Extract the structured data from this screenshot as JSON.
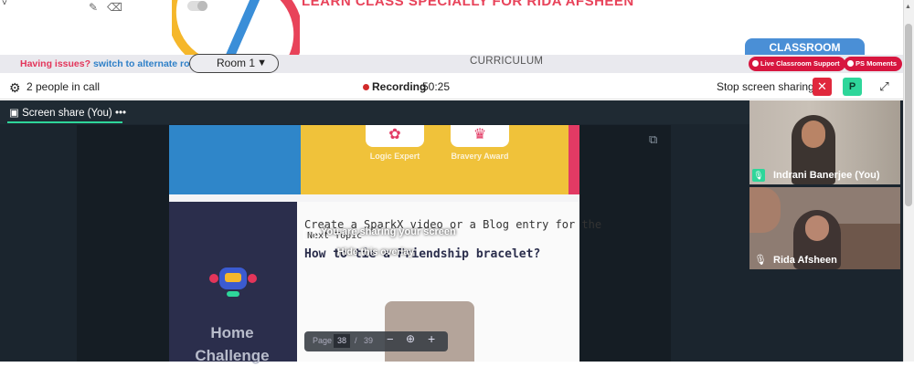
{
  "banner": {
    "title": "LEARN CLASS SPECIALLY FOR RIDA AFSHEEN"
  },
  "classroom_tab": "CLASSROOM",
  "room_bar": {
    "issues_text": "Having issues?",
    "switch_text": "switch to alternate room",
    "room_selected": "Room 1",
    "curriculum": "CURRICULUM",
    "support_pill": "Live Classroom Support",
    "moments_pill": "PS Moments"
  },
  "meeting": {
    "people": "2 people in call",
    "recording_label": "Recording",
    "recording_time": "50:25",
    "stop_sharing": "Stop screen sharing",
    "avatar_initial": "P"
  },
  "screen_share": {
    "tab_label": "Screen share (You)",
    "tab_menu": "•••",
    "overlay_title": "You are sharing your screen",
    "overlay_hide": "Hide this overlay"
  },
  "document": {
    "badge1": "Logic Expert",
    "badge2": "Bravery Award",
    "line1": "Create a SparkX video or a Blog entry for the",
    "line2": "Next Topic",
    "heading": "How to tie a Friendship bracelet?",
    "home_challenge": "Home Challenge"
  },
  "pager": {
    "label": "Page",
    "current": "38",
    "separator": "/",
    "total": "39"
  },
  "participants": [
    {
      "name": "Indrani Banerjee (You)"
    },
    {
      "name": "Rida Afsheen"
    }
  ],
  "colors": {
    "accent_green": "#2ed69a",
    "danger_red": "#e0283d",
    "brand_pink": "#e3355a",
    "brand_blue": "#2f80c8"
  }
}
